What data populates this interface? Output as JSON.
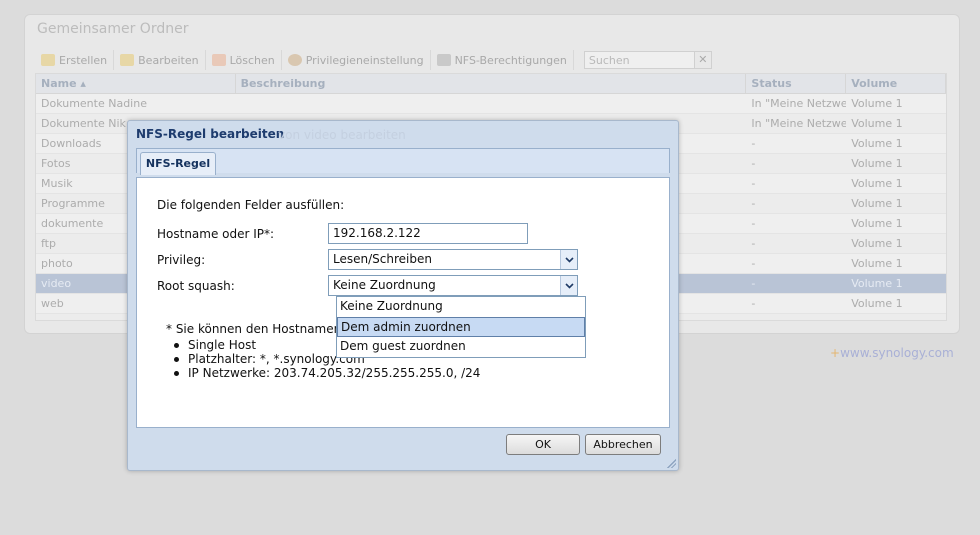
{
  "background_window": {
    "title": "Gemeinsamer Ordner",
    "toolbar": {
      "create": "Erstellen",
      "edit": "Bearbeiten",
      "delete": "Löschen",
      "privileges": "Privilegieneinstellung",
      "nfs": "NFS-Berechtigungen",
      "search_placeholder": "Suchen"
    },
    "columns": [
      "Name ▴",
      "Beschreibung",
      "Status",
      "Volume"
    ],
    "rows": [
      {
        "name": "Dokumente Nadine",
        "desc": "",
        "status": "In \"Meine Netzwerk",
        "volume": "Volume 1"
      },
      {
        "name": "Dokumente Nik",
        "desc": "",
        "status": "In \"Meine Netzwerk",
        "volume": "Volume 1"
      },
      {
        "name": "Downloads",
        "desc": "",
        "status": "-",
        "volume": "Volume 1"
      },
      {
        "name": "Fotos",
        "desc": "",
        "status": "-",
        "volume": "Volume 1"
      },
      {
        "name": "Musik",
        "desc": "",
        "status": "-",
        "volume": "Volume 1"
      },
      {
        "name": "Programme",
        "desc": "",
        "status": "-",
        "volume": "Volume 1"
      },
      {
        "name": "dokumente",
        "desc": "",
        "status": "-",
        "volume": "Volume 1"
      },
      {
        "name": "ftp",
        "desc": "",
        "status": "-",
        "volume": "Volume 1"
      },
      {
        "name": "photo",
        "desc": "",
        "status": "-",
        "volume": "Volume 1"
      },
      {
        "name": "video",
        "desc": "",
        "status": "-",
        "volume": "Volume 1"
      },
      {
        "name": "web",
        "desc": "",
        "status": "-",
        "volume": "Volume 1"
      }
    ],
    "ghost_title_fragment": "von video bearbeiten",
    "logo": {
      "plus": "+",
      "text": "www.synology.com"
    }
  },
  "dialog": {
    "title": "NFS-Regel bearbeiten",
    "tab": "NFS-Regel",
    "intro": "Die folgenden Felder ausfüllen:",
    "hostname_label": "Hostname oder IP*:",
    "hostname_value": "192.168.2.122",
    "privilege_label": "Privileg:",
    "privilege_value": "Lesen/Schreiben",
    "root_squash_label": "Root squash:",
    "root_squash_value": "Keine Zuordnung",
    "root_squash_options": [
      "Keine Zuordnung",
      "Dem admin zuordnen",
      "Dem guest zuordnen"
    ],
    "note": "* Sie können den Hostnamen",
    "bullets": [
      "Single Host",
      "Platzhalter: *, *.synology.com",
      "IP Netzwerke: 203.74.205.32/255.255.255.0, /24"
    ],
    "ok": "OK",
    "cancel": "Abbrechen"
  },
  "colors": {
    "selected_row": "#b9c4d6",
    "dialog_title": "#1e3c6e",
    "highlight_option": "#c7daf3"
  }
}
